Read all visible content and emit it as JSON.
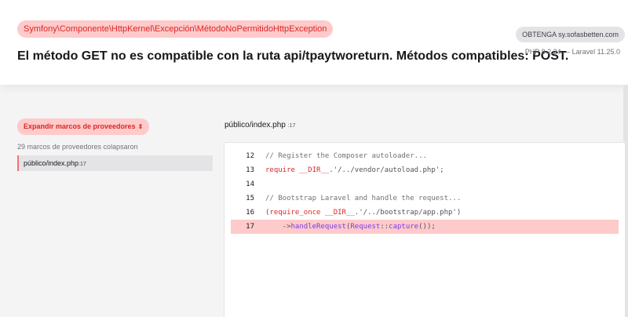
{
  "header": {
    "exception_class": "Symfony\\Componente\\HttpKernel\\Excepción\\MétodoNoPermitidoHttpException",
    "message": "El método GET no es compatible con la ruta api/tpaytworeturn. Métodos compatibles: POST.",
    "request_pill": "OBTENGA sy.sofasbetten.com",
    "versions": "PHP 8.2.24 — Laravel 11.25.0"
  },
  "sidebar": {
    "expand_button_label": "Expandir marcos de proveedores",
    "expand_icon": "chevron-up-down-icon",
    "collapsed_count": "29 marcos de proveedores colapsaron",
    "frames": [
      {
        "file": "público/index.php",
        "line": ":17"
      }
    ]
  },
  "editor": {
    "file": "público/index.php",
    "line": ":17",
    "highlight_line": 17,
    "lines": [
      {
        "n": "12",
        "tokens": [
          {
            "t": "// Register the Composer autoloader...",
            "c": "com"
          }
        ]
      },
      {
        "n": "13",
        "tokens": [
          {
            "t": "require __DIR__",
            "c": "kw"
          },
          {
            "t": ".'/../vendor/autoload.php';",
            "c": "str"
          }
        ]
      },
      {
        "n": "14",
        "tokens": []
      },
      {
        "n": "15",
        "tokens": [
          {
            "t": "// Bootstrap Laravel and handle the request...",
            "c": "com"
          }
        ]
      },
      {
        "n": "16",
        "tokens": [
          {
            "t": "(",
            "c": "str"
          },
          {
            "t": "require_once __DIR__",
            "c": "kw"
          },
          {
            "t": ".'/../bootstrap/app.php')",
            "c": "str"
          }
        ]
      },
      {
        "n": "17",
        "tokens": [
          {
            "t": "    ->",
            "c": "str"
          },
          {
            "t": "handleRequest",
            "c": "fn"
          },
          {
            "t": "(",
            "c": "str"
          },
          {
            "t": "Request",
            "c": "fn"
          },
          {
            "t": "::",
            "c": "str"
          },
          {
            "t": "capture",
            "c": "fn"
          },
          {
            "t": "());",
            "c": "str"
          }
        ]
      }
    ]
  },
  "colors": {
    "accent_red": "#dc2626",
    "accent_pink": "#fecaca",
    "background": "#f4f4f5"
  }
}
